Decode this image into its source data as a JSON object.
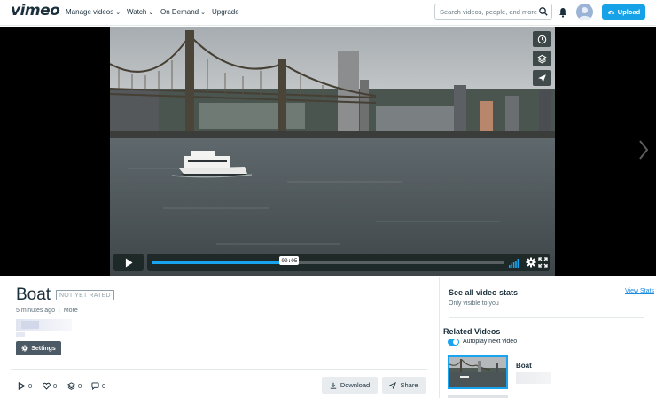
{
  "nav": {
    "logo": "vimeo",
    "links": [
      {
        "label": "Manage videos",
        "chevron": true
      },
      {
        "label": "Watch",
        "chevron": true
      },
      {
        "label": "On Demand",
        "chevron": true
      },
      {
        "label": "Upgrade",
        "chevron": false
      }
    ],
    "search_placeholder": "Search videos, people, and more",
    "upload_label": "Upload",
    "colors": {
      "accent": "#17a2e8",
      "text": "#1a2e3b"
    }
  },
  "player": {
    "current_time": "00:05",
    "progress": 0.39,
    "side_buttons": [
      "clock-icon",
      "layers-icon",
      "send-icon"
    ]
  },
  "video": {
    "title": "Boat",
    "rating_badge": "NOT YET RATED",
    "uploaded": "5 minutes ago",
    "more_label": "More",
    "settings_label": "Settings",
    "stats": {
      "plays": "0",
      "likes": "0",
      "collections": "0",
      "comments": "0"
    },
    "download_label": "Download",
    "share_label": "Share"
  },
  "sidebar": {
    "stats_title": "See all video stats",
    "view_stats_link": "View Stats",
    "visibility_note": "Only visible to you",
    "related_title": "Related Videos",
    "autoplay_label": "Autoplay next video",
    "related_items": [
      {
        "title": "Boat"
      }
    ]
  }
}
